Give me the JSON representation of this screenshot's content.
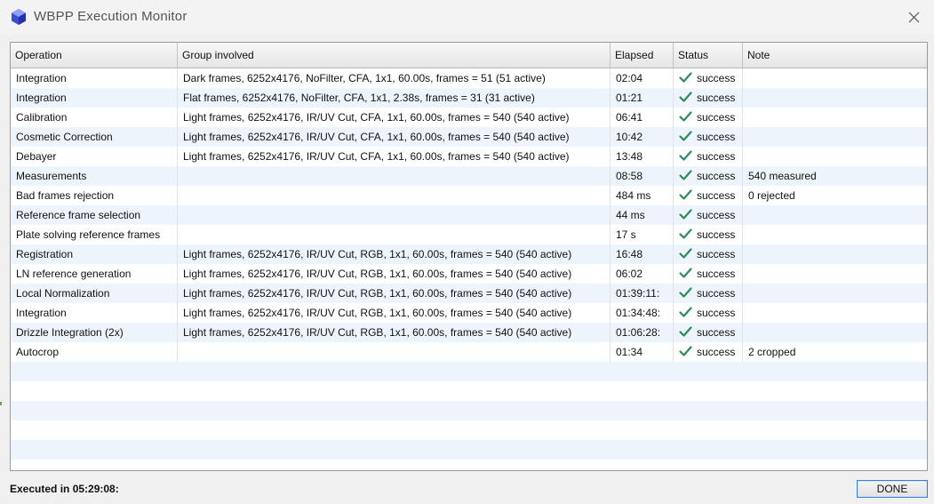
{
  "window": {
    "title": "WBPP Execution Monitor",
    "icon": "wbpp-cube-icon",
    "close_icon": "close-icon"
  },
  "table": {
    "columns": [
      "Operation",
      "Group involved",
      "Elapsed",
      "Status",
      "Note"
    ],
    "rows": [
      {
        "operation": "Integration",
        "group": "Dark frames, 6252x4176, NoFilter, CFA, 1x1, 60.00s, frames = 51 (51 active)",
        "elapsed": "02:04",
        "status": "success",
        "note": ""
      },
      {
        "operation": "Integration",
        "group": "Flat frames, 6252x4176, NoFilter, CFA, 1x1, 2.38s, frames = 31 (31 active)",
        "elapsed": "01:21",
        "status": "success",
        "note": ""
      },
      {
        "operation": "Calibration",
        "group": "Light frames, 6252x4176, IR/UV Cut, CFA, 1x1, 60.00s, frames = 540 (540 active)",
        "elapsed": "06:41",
        "status": "success",
        "note": ""
      },
      {
        "operation": "Cosmetic Correction",
        "group": "Light frames, 6252x4176, IR/UV Cut, CFA, 1x1, 60.00s, frames = 540 (540 active)",
        "elapsed": "10:42",
        "status": "success",
        "note": ""
      },
      {
        "operation": "Debayer",
        "group": "Light frames, 6252x4176, IR/UV Cut, CFA, 1x1, 60.00s, frames = 540 (540 active)",
        "elapsed": "13:48",
        "status": "success",
        "note": ""
      },
      {
        "operation": "Measurements",
        "group": "",
        "elapsed": "08:58",
        "status": "success",
        "note": "540 measured"
      },
      {
        "operation": "Bad frames rejection",
        "group": "",
        "elapsed": "484 ms",
        "status": "success",
        "note": "0 rejected"
      },
      {
        "operation": "Reference frame selection",
        "group": "",
        "elapsed": "44 ms",
        "status": "success",
        "note": ""
      },
      {
        "operation": "Plate solving reference frames",
        "group": "",
        "elapsed": "17 s",
        "status": "success",
        "note": ""
      },
      {
        "operation": "Registration",
        "group": "Light frames, 6252x4176, IR/UV Cut, RGB, 1x1, 60.00s, frames = 540 (540 active)",
        "elapsed": "16:48",
        "status": "success",
        "note": ""
      },
      {
        "operation": "LN reference generation",
        "group": "Light frames, 6252x4176, IR/UV Cut, RGB, 1x1, 60.00s, frames = 540 (540 active)",
        "elapsed": "06:02",
        "status": "success",
        "note": ""
      },
      {
        "operation": "Local Normalization",
        "group": "Light frames, 6252x4176, IR/UV Cut, RGB, 1x1, 60.00s, frames = 540 (540 active)",
        "elapsed": "01:39:11:",
        "status": "success",
        "note": ""
      },
      {
        "operation": "Integration",
        "group": "Light frames, 6252x4176, IR/UV Cut, RGB, 1x1, 60.00s, frames = 540 (540 active)",
        "elapsed": "01:34:48:",
        "status": "success",
        "note": ""
      },
      {
        "operation": "Drizzle Integration (2x)",
        "group": "Light frames, 6252x4176, IR/UV Cut, RGB, 1x1, 60.00s, frames = 540 (540 active)",
        "elapsed": "01:06:28:",
        "status": "success",
        "note": ""
      },
      {
        "operation": "Autocrop",
        "group": "",
        "elapsed": "01:34",
        "status": "success",
        "note": "2 cropped"
      }
    ],
    "status_icon": "check-icon",
    "empty_rows": 6
  },
  "footer": {
    "executed_label": "Executed in 05:29:08:",
    "done_label": "DONE"
  },
  "colors": {
    "check": "#2e8b57",
    "alt_row": "#eef4fb",
    "done_border": "#3c7fd6",
    "icon_blue": "#3a4fd0"
  }
}
